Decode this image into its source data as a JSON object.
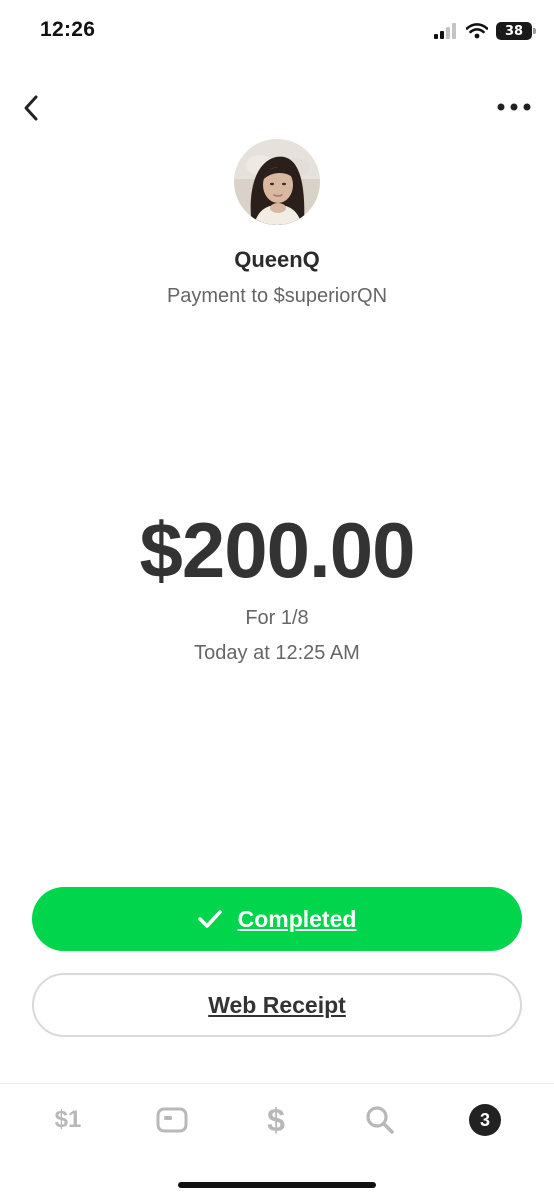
{
  "status_bar": {
    "time": "12:26",
    "battery": "38"
  },
  "header": {
    "back_icon": "chevron-left-icon",
    "more_icon": "ellipsis-icon"
  },
  "recipient": {
    "name": "QueenQ",
    "subtitle": "Payment to $superiorQN"
  },
  "payment": {
    "amount": "$200.00",
    "note": "For 1/8",
    "timestamp": "Today at 12:25 AM"
  },
  "buttons": {
    "completed_label": "Completed",
    "web_receipt_label": "Web Receipt"
  },
  "bottom_nav": {
    "money_label": "$1",
    "pay_label": "$",
    "activity_badge": "3"
  },
  "colors": {
    "accent_green": "#00d54b",
    "text_dark": "#2b2b2b",
    "text_muted": "#666666",
    "nav_inactive": "#b8b8b8"
  }
}
